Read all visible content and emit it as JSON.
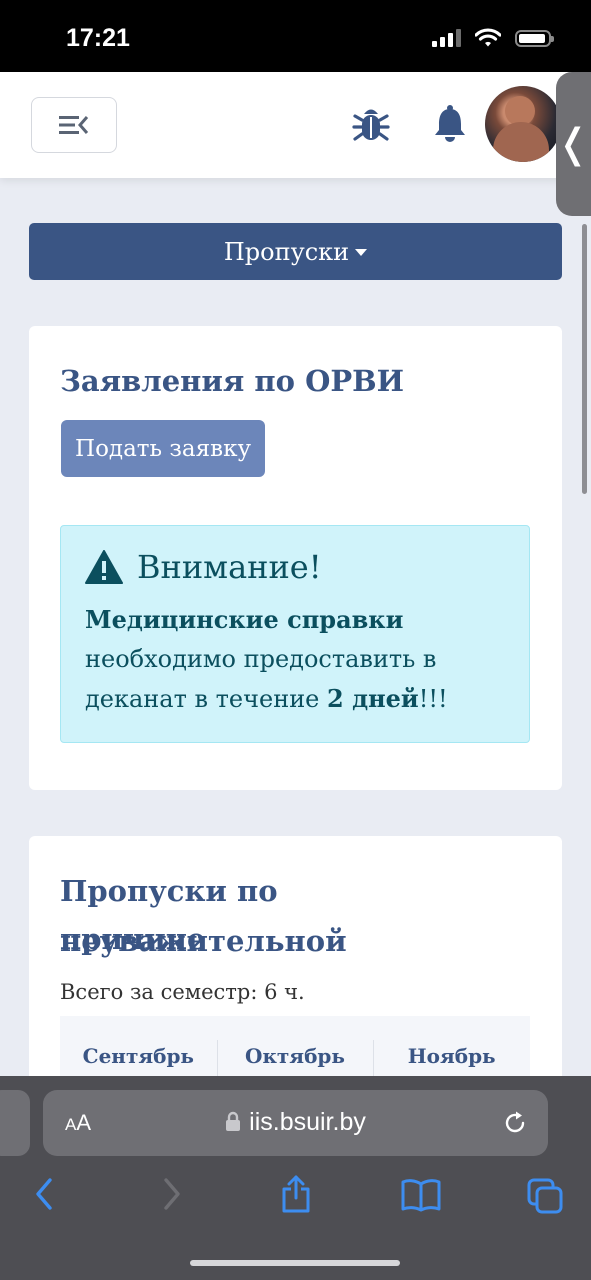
{
  "status_bar": {
    "time": "17:21"
  },
  "header": {
    "menu_icon": "menu-collapse-icon",
    "bug_icon": "bug-icon",
    "bell_icon": "bell-icon",
    "avatar": "avatar"
  },
  "colors": {
    "primary": "#3a5584",
    "button": "#6c86ba",
    "alert_bg": "#d0f3fa",
    "alert_text": "#0b4f5e",
    "page_bg": "#e9ecf3"
  },
  "nav_dropdown": {
    "label": "Пропуски"
  },
  "orvi_card": {
    "title": "Заявления по ОРВИ",
    "submit_button": "Подать заявку",
    "alert": {
      "title": "Внимание!",
      "bold_lead": "Медицинские справки",
      "text_mid": " необходимо предоставить в деканат в течение ",
      "bold_days": "2 дней",
      "text_end": "!!!"
    }
  },
  "absence_card": {
    "title_line1": "Пропуски по неуважительной",
    "title_line2": "причине",
    "total": "Всего за семестр: 6 ч.",
    "months": [
      "Сентябрь",
      "Октябрь",
      "Ноябрь"
    ]
  },
  "browser": {
    "text_size_button": "AA",
    "url": "iis.bsuir.by"
  }
}
